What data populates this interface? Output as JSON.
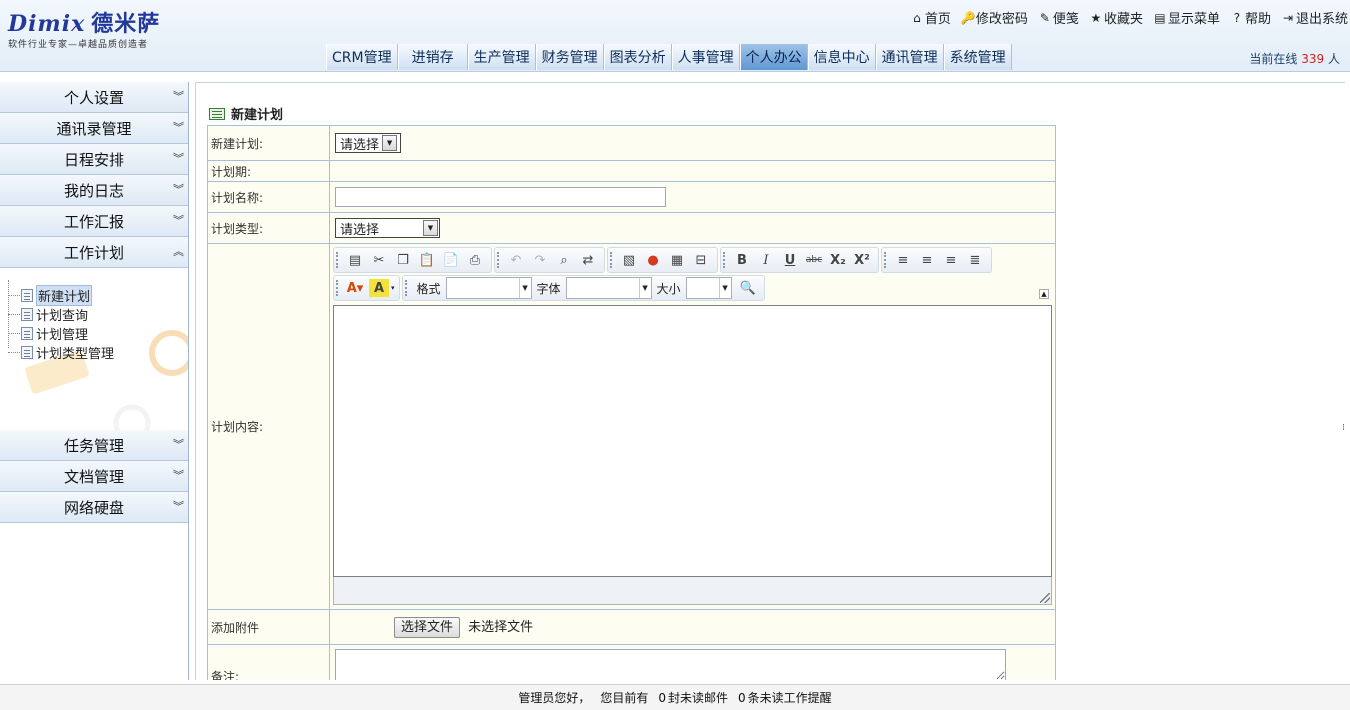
{
  "logo": {
    "brand": "Dimix",
    "brand_cn": "德米萨",
    "slogan": "软件行业专家—卓越品质创造者"
  },
  "toplinks": [
    {
      "label": "首页",
      "icon": "home-icon",
      "glyph": "⌂"
    },
    {
      "label": "修改密码",
      "icon": "key-icon",
      "glyph": "🔑"
    },
    {
      "label": "便笺",
      "icon": "notepad-icon",
      "glyph": "✎"
    },
    {
      "label": "收藏夹",
      "icon": "star-icon",
      "glyph": "★"
    },
    {
      "label": "显示菜单",
      "icon": "menu-icon",
      "glyph": "▤"
    },
    {
      "label": "帮助",
      "icon": "help-icon",
      "glyph": "?"
    },
    {
      "label": "退出系统",
      "icon": "exit-icon",
      "glyph": "⇥"
    }
  ],
  "nav": {
    "tabs": [
      "CRM管理",
      "进销存",
      "生产管理",
      "财务管理",
      "图表分析",
      "人事管理",
      "个人办公",
      "信息中心",
      "通讯管理",
      "系统管理"
    ],
    "active_index": 6
  },
  "online": {
    "prefix": "当前在线",
    "count": "339",
    "suffix": "人"
  },
  "sidebar": {
    "top_items": [
      "个人设置",
      "通讯录管理",
      "日程安排",
      "我的日志",
      "工作汇报"
    ],
    "expanded": {
      "label": "工作计划",
      "children": [
        "新建计划",
        "计划查询",
        "计划管理",
        "计划类型管理"
      ],
      "selected_index": 0
    },
    "bottom_items": [
      "任务管理",
      "文档管理",
      "网络硬盘"
    ]
  },
  "form": {
    "title": "新建计划",
    "rows": {
      "new_plan": {
        "label": "新建计划:",
        "select": "请选择"
      },
      "period": {
        "label": "计划期:"
      },
      "name": {
        "label": "计划名称:",
        "value": ""
      },
      "type": {
        "label": "计划类型:",
        "select": "请选择"
      },
      "content": {
        "label": "计划内容:"
      },
      "attachment": {
        "label": "添加附件",
        "button": "选择文件",
        "status": "未选择文件"
      },
      "notes": {
        "label": "备注:"
      }
    },
    "editor": {
      "format_label": "格式",
      "font_label": "字体",
      "size_label": "大小"
    }
  },
  "footer": {
    "greeting": "管理员您好，",
    "mail_prefix": "您目前有",
    "mail_count": "0",
    "mail_suffix": "封未读邮件",
    "remind_count": "0",
    "remind_suffix": "条未读工作提醒"
  }
}
